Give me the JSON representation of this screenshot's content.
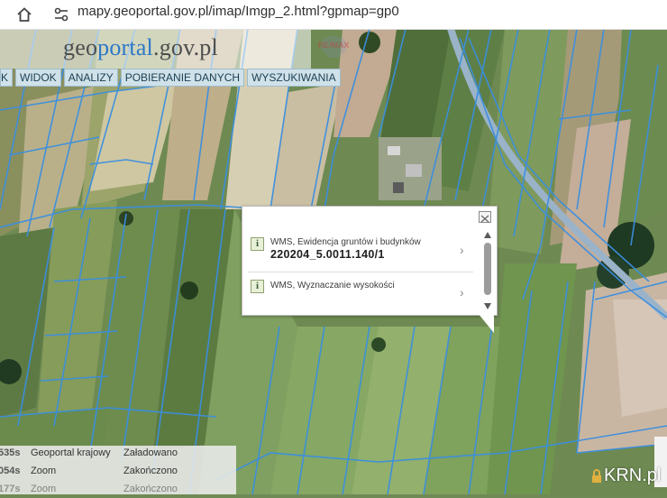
{
  "browser": {
    "url": "mapy.geoportal.gov.pl/imap/Imgp_2.html?gpmap=gp0"
  },
  "header": {
    "logo_prefix": "geo",
    "logo_accent": "portal",
    "logo_suffix": ".gov.pl"
  },
  "menu": {
    "items": [
      {
        "label": "K"
      },
      {
        "label": "WIDOK"
      },
      {
        "label": "ANALIZY"
      },
      {
        "label": "POBIERANIE DANYCH"
      },
      {
        "label": "WYSZUKIWANIA"
      }
    ]
  },
  "popup": {
    "rows": [
      {
        "layer": "WMS, Ewidencja gruntów i budynków",
        "value": "220204_5.0011.140/1"
      },
      {
        "layer": "WMS, Wyznaczanie wysokości"
      }
    ]
  },
  "status_log": [
    {
      "time": "535s",
      "source": "Geoportal krajowy",
      "status": "Załadowano"
    },
    {
      "time": "054s",
      "source": "Zoom",
      "status": "Zakończono"
    },
    {
      "time": "177s",
      "source": "Zoom",
      "status": "Zakończono"
    }
  ],
  "watermarks": {
    "remax": "RE/MAX",
    "krn": "KRN.pl"
  },
  "colors": {
    "parcel_lines": "#3a8fe0",
    "menu_bg": "#cfe1e9",
    "logo_accent": "#2d78c8"
  }
}
